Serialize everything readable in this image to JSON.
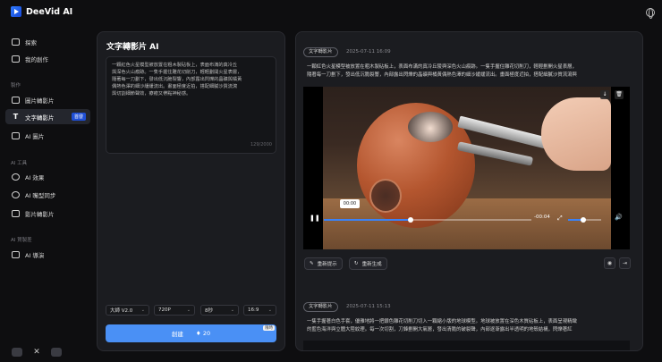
{
  "app": {
    "name": "DeeVid AI"
  },
  "sidebar": {
    "top_items": [
      {
        "label": "探索",
        "icon": "explore-icon"
      },
      {
        "label": "我的創作",
        "icon": "folder-icon"
      }
    ],
    "sections": [
      {
        "title": "製作",
        "items": [
          {
            "label": "圖片轉影片",
            "icon": "image-to-video-icon"
          },
          {
            "label": "文字轉影片",
            "icon": "text-icon",
            "badge": "首發",
            "active": true
          },
          {
            "label": "AI 圖片",
            "icon": "ai-image-icon"
          }
        ]
      },
      {
        "title": "AI 工具",
        "items": [
          {
            "label": "AI 效果",
            "icon": "sparkle-icon"
          },
          {
            "label": "AI 嘴型同步",
            "icon": "lip-sync-icon"
          },
          {
            "label": "影片轉影片",
            "icon": "video-icon"
          }
        ]
      },
      {
        "title": "AI 賀製差",
        "items": [
          {
            "label": "AI 導演",
            "icon": "director-icon"
          }
        ]
      }
    ],
    "social": [
      "discord-icon",
      "x-icon",
      "youtube-icon"
    ]
  },
  "composer": {
    "title": "文字轉影片 AI",
    "prompt_lines": [
      "一顆紅色火星模型被放置在粗木製砧板上，表面布滿的真冷丘",
      "與深色火山痕跡。一隻手握住雕花切削刀，輕輕劃開火星表層，",
      "隨著每一刀劃下，發出低沉脆裂響，內部露出閃爍的晶礦與橘黃",
      "偶熱色澤的細沙緩緩流出。畫面極度近拍，搭配細膩沙質流瀉",
      "與切割細節聲效，療癒又帶點神秘感。"
    ],
    "char_count": "129/2000",
    "options": {
      "model": "大師 V2.0",
      "resolution": "720P",
      "duration": "8秒",
      "ratio": "16:9"
    },
    "generate": {
      "label": "創建",
      "cost": "20",
      "tag": "限時"
    }
  },
  "results": [
    {
      "tag": "文字轉影片",
      "timestamp": "2025-07-11 16:09",
      "prompt_lines": [
        "一顆紅色火星模型被放置在粗木製砧板上，表面布滿的真冷丘陵與深色火山痕跡。一隻手握住雕花切削刀，輕輕劃開火星表層，",
        "隨著每一刀劃下，發出低沉脆裂響，內部露出閃爍的晶礦與橘黃偶熱色澤的細沙緩緩流出。畫面極度近拍，搭配細膩沙質流瀉與"
      ],
      "player": {
        "tooltip_time": "00:00",
        "remaining": "-00:04",
        "progress": 0.42,
        "volume": 0.45
      },
      "actions": {
        "reuse": "重新提示",
        "regenerate": "重新生成"
      }
    },
    {
      "tag": "文字轉影片",
      "timestamp": "2025-07-11 15:13",
      "prompt_lines": [
        "一隻手握著白色手套，優雅地將一把銀色雕花切削刀切入一顆縮小版的地球模型。地球被放置在深色木質砧板上，表面呈現精緻",
        "的藍色海洋與立體大陸紋理。每一次切割，刀鋒劃開大氣層，發出清脆的破裂聲，內部逐漸露出半透明的地殼結構，閃爍著紅"
      ]
    }
  ]
}
